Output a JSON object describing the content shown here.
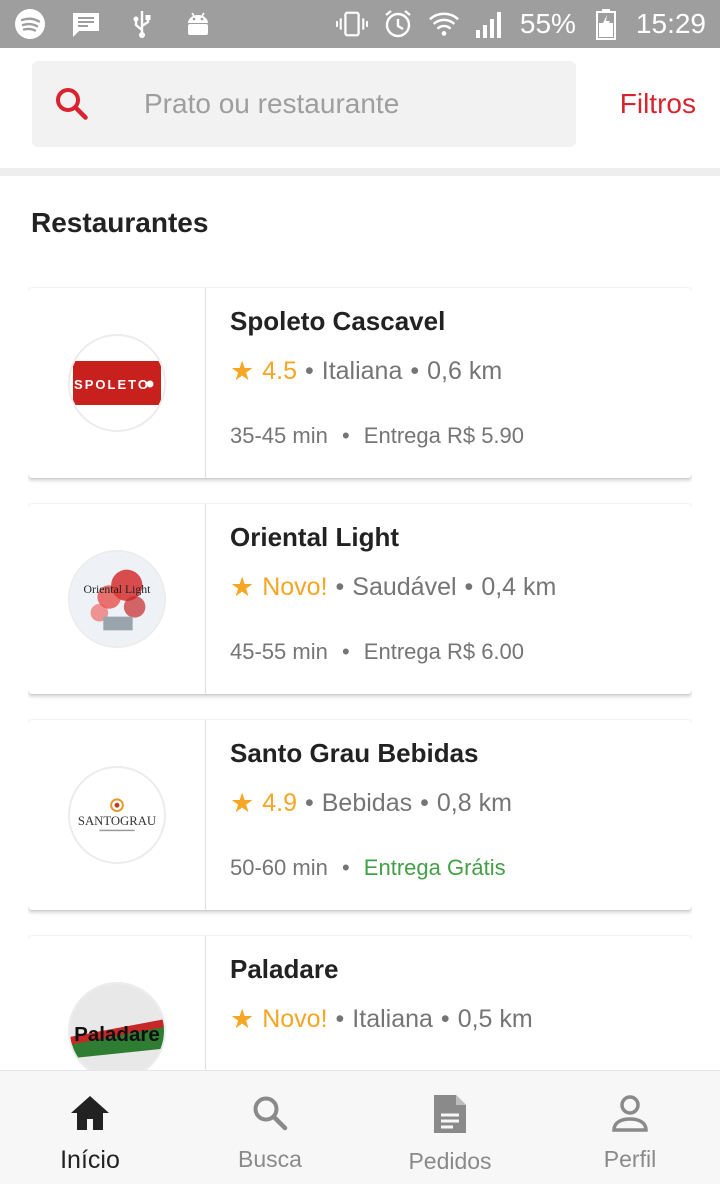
{
  "status_bar": {
    "battery": "55%",
    "time": "15:29",
    "left_icons": [
      "spotify-icon",
      "message-icon",
      "usb-icon",
      "android-icon"
    ],
    "right_icons": [
      "vibrate-icon",
      "alarm-icon",
      "wifi-icon",
      "signal-icon",
      "battery-icon"
    ]
  },
  "search": {
    "placeholder": "Prato ou restaurante",
    "filters_label": "Filtros",
    "accent_color": "#d9232e"
  },
  "section_title": "Restaurantes",
  "restaurants": [
    {
      "name": "Spoleto Cascavel",
      "rating": "4.5",
      "category": "Italiana",
      "distance": "0,6 km",
      "time": "35-45 min",
      "delivery": "Entrega R$ 5.90",
      "free_delivery": false,
      "logo_text": "SPOLETO"
    },
    {
      "name": "Oriental Light",
      "rating": "Novo!",
      "category": "Saudável",
      "distance": "0,4 km",
      "time": "45-55 min",
      "delivery": "Entrega R$ 6.00",
      "free_delivery": false,
      "logo_text": "Oriental Light"
    },
    {
      "name": "Santo Grau Bebidas",
      "rating": "4.9",
      "category": "Bebidas",
      "distance": "0,8 km",
      "time": "50-60 min",
      "delivery": "Entrega Grátis",
      "free_delivery": true,
      "logo_text": "SANTOGRAU"
    },
    {
      "name": "Paladare",
      "rating": "Novo!",
      "category": "Italiana",
      "distance": "0,5 km",
      "time": "",
      "delivery": "",
      "free_delivery": false,
      "logo_text": "Paladare"
    }
  ],
  "bottom_nav": [
    {
      "label": "Início",
      "icon": "home-icon",
      "active": true
    },
    {
      "label": "Busca",
      "icon": "search-icon",
      "active": false
    },
    {
      "label": "Pedidos",
      "icon": "document-icon",
      "active": false
    },
    {
      "label": "Perfil",
      "icon": "person-icon",
      "active": false
    }
  ],
  "colors": {
    "rating": "#f5a623",
    "free_delivery": "#43a047",
    "brand_red": "#d9232e"
  }
}
